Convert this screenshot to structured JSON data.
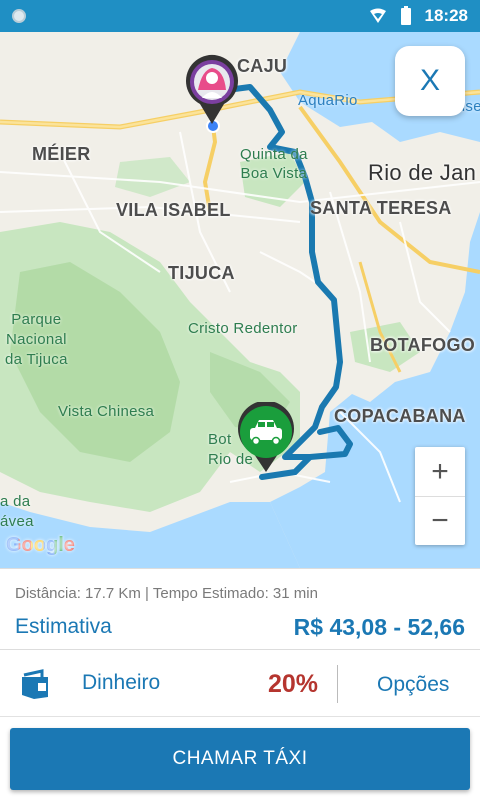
{
  "status_bar": {
    "time": "18:28"
  },
  "map": {
    "labels": {
      "caju": "CAJU",
      "aquario": "AquaRio",
      "museu": "Museu",
      "meier": "MÉIER",
      "quinta": "Quinta da\nBoa Vista",
      "rio": "Rio de Jan",
      "vila_isabel": "VILA ISABEL",
      "santa_teresa": "SANTA TERESA",
      "tijuca": "TIJUCA",
      "parque": "Parque\nNacional\nda Tijuca",
      "cristo": "Cristo Redentor",
      "botafogo": "BOTAFOGO",
      "vista_chinesa": "Vista Chinesa",
      "copacabana": "COPACABANA",
      "jardim": "Bot\nRio de",
      "gavea": "a da\návea"
    },
    "close_label": "X",
    "zoom_in": "+",
    "zoom_out": "−",
    "attribution": "Google"
  },
  "trip": {
    "info_line": "Distância: 17.7 Km | Tempo Estimado: 31 min",
    "estimate_label": "Estimativa",
    "estimate_value": "R$ 43,08 - 52,66"
  },
  "payment": {
    "method_label": "Dinheiro",
    "discount": "20%",
    "options_label": "Opções",
    "icon": "wallet-icon"
  },
  "actions": {
    "call_taxi_label": "CHAMAR TÁXI"
  },
  "colors": {
    "primary": "#1b78b4",
    "status_bar": "#1f8fc4",
    "discount": "#b5352f",
    "route": "#1a79b0",
    "water": "#aadaff",
    "park": "#c8e6c0"
  }
}
